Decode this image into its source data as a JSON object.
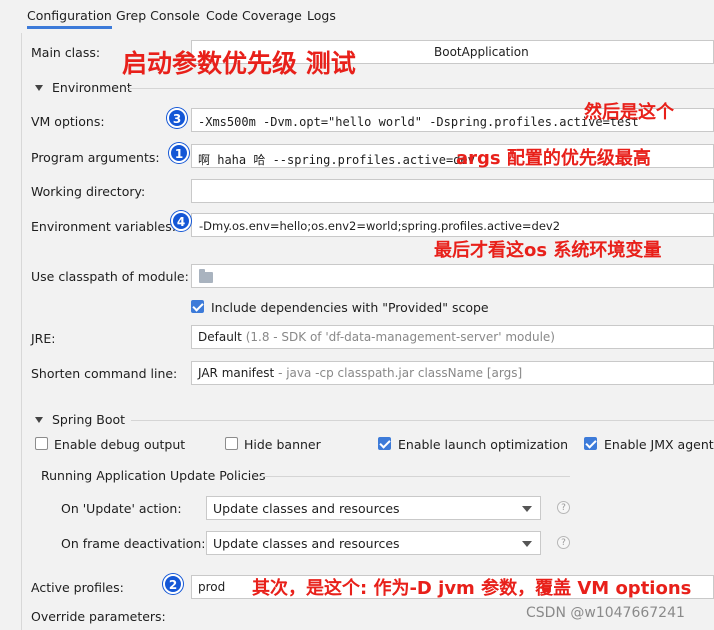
{
  "tabs": [
    "Configuration",
    "Grep Console",
    "Code Coverage",
    "Logs"
  ],
  "main_class": {
    "label": "Main class:",
    "value": "BootApplication"
  },
  "environment": {
    "section_label": "Environment",
    "vm_options": {
      "label": "VM options:",
      "value": "-Xms500m -Dvm.opt=\"hello world\" -Dspring.profiles.active=test"
    },
    "program_arguments": {
      "label": "Program arguments:",
      "value": "啊 haha 哈 --spring.profiles.active=dev"
    },
    "working_directory": {
      "label": "Working directory:",
      "value": ""
    },
    "environment_variables": {
      "label": "Environment variables:",
      "value": "-Dmy.os.env=hello;os.env2=world;spring.profiles.active=dev2"
    },
    "classpath_module": {
      "label": "Use classpath of module:",
      "value": ""
    },
    "include_dependencies": {
      "label": "Include dependencies with \"Provided\" scope",
      "checked": true
    },
    "jre": {
      "label": "JRE:",
      "value": "Default",
      "hint": "(1.8 - SDK of 'df-data-management-server' module)"
    },
    "shorten_command_line": {
      "label": "Shorten command line:",
      "value": "JAR manifest",
      "hint": "- java -cp classpath.jar className [args]"
    }
  },
  "spring_boot": {
    "section_label": "Spring Boot",
    "checkboxes": [
      {
        "label": "Enable debug output",
        "checked": false
      },
      {
        "label": "Hide banner",
        "checked": false
      },
      {
        "label": "Enable launch optimization",
        "checked": true
      },
      {
        "label": "Enable JMX agent",
        "checked": true
      }
    ],
    "policies_title": "Running Application Update Policies",
    "on_update": {
      "label": "On 'Update' action:",
      "value": "Update classes and resources"
    },
    "on_frame_deactivation": {
      "label": "On frame deactivation:",
      "value": "Update classes and resources"
    },
    "help_glyph": "?",
    "active_profiles": {
      "label": "Active profiles:",
      "value": "prod"
    },
    "override_parameters": {
      "label": "Override parameters:"
    }
  },
  "annotations": {
    "title": "启动参数优先级 测试",
    "vm_note": "然后是这个",
    "args_note": "args 配置的优先级最高",
    "env_note": "最后才看这os 系统环境变量",
    "profiles_note": "其次，是这个: 作为-D jvm 参数，覆盖 VM options"
  },
  "badges": [
    "3",
    "1",
    "4",
    "2"
  ],
  "watermark": "CSDN @w1047667241",
  "colors": {
    "accent": "#3d7bd9",
    "annotation_red": "#e8201a",
    "badge_blue": "#1457d6"
  }
}
